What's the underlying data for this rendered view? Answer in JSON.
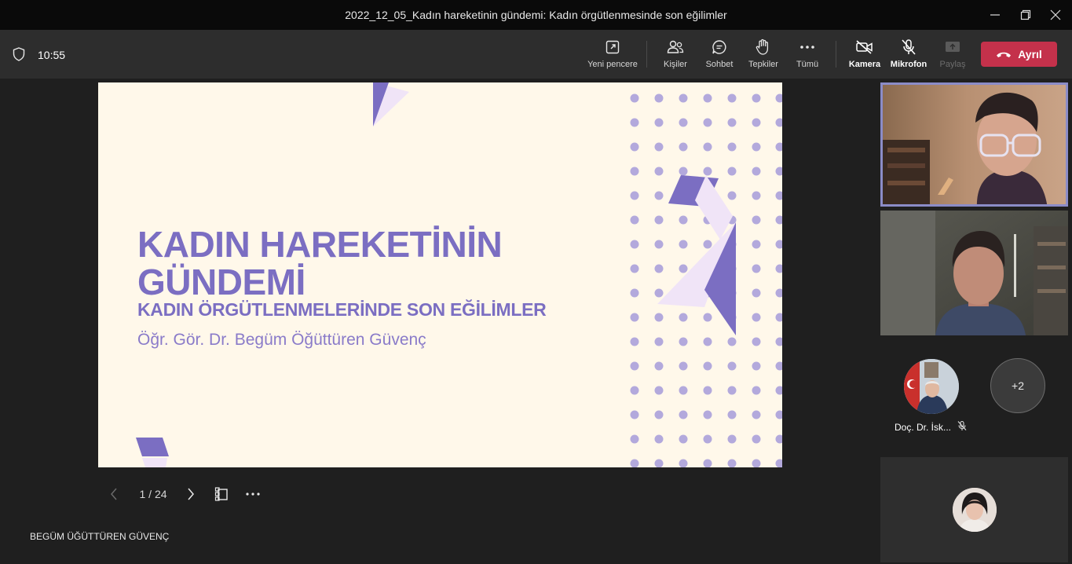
{
  "window": {
    "title": "2022_12_05_Kadın hareketinin gündemi: Kadın örgütlenmesinde son eğilimler"
  },
  "toolbar": {
    "time": "10:55",
    "new_window": "Yeni pencere",
    "people": "Kişiler",
    "chat": "Sohbet",
    "reactions": "Tepkiler",
    "more": "Tümü",
    "camera": "Kamera",
    "mic": "Mikrofon",
    "share": "Paylaş",
    "leave": "Ayrıl",
    "leave_color": "#c4314b"
  },
  "slide": {
    "title_line1": "KADIN HAREKETİNİN",
    "title_line2": "GÜNDEMİ",
    "subtitle": "KADIN ÖRGÜTLENMELERİNDE SON EĞİLİMLER",
    "author": "Öğr. Gör. Dr. Begüm Öğüttüren Güvenç",
    "accent_color": "#7b6ec2",
    "background_color": "#fff8ea"
  },
  "slide_nav": {
    "page": "1 / 24"
  },
  "presenter_name": "BEGÜM ÜĞÜTTÜREN GÜVENÇ",
  "participants": {
    "isk_name": "Doç. Dr. İsk...",
    "more_count": "+2"
  }
}
